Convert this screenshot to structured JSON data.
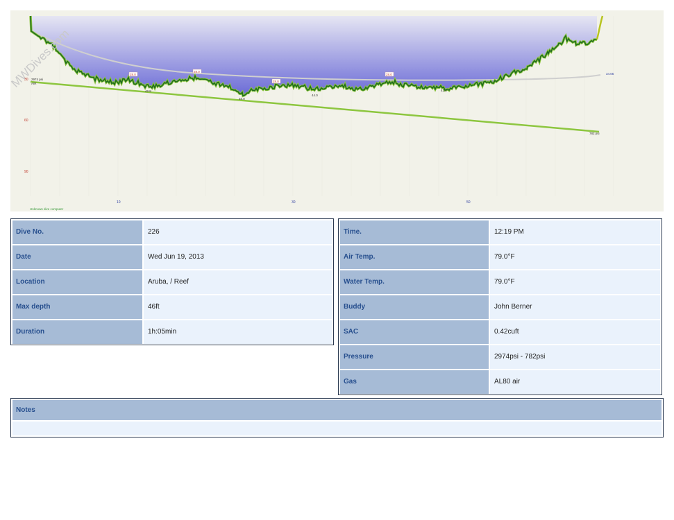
{
  "watermark": "MWDives.com",
  "chart_data": {
    "type": "line",
    "y_ticks": [
      "30",
      "60",
      "90"
    ],
    "x_ticks": [
      "10",
      "30",
      "50"
    ],
    "computer_label": "Unknown dive computer",
    "pressure_start_label": "2974 psi",
    "pressure_start_sub": "AIR",
    "pressure_end_label": "782 psi",
    "temp_end_label": "34.05",
    "depth_labels": [
      "42.8",
      "46.0",
      "44.0",
      "41.0"
    ],
    "temp_labels": [
      "28.0",
      "28.0",
      "28.0",
      "28.0"
    ],
    "xlim": [
      0,
      65
    ],
    "ylim": [
      0,
      100
    ],
    "max_depth": 46,
    "pressure": {
      "start": 2974,
      "end": 782
    }
  },
  "left_table": [
    {
      "label": "Dive No.",
      "value": "226"
    },
    {
      "label": "Date",
      "value": "Wed Jun 19, 2013"
    },
    {
      "label": "Location",
      "value": "Aruba, / Reef"
    },
    {
      "label": "Max depth",
      "value": "46ft"
    },
    {
      "label": "Duration",
      "value": "1h:05min"
    }
  ],
  "right_table": [
    {
      "label": "Time.",
      "value": "12:19 PM"
    },
    {
      "label": "Air Temp.",
      "value": "79.0°F"
    },
    {
      "label": "Water Temp.",
      "value": "79.0°F"
    },
    {
      "label": "Buddy",
      "value": "John Berner"
    },
    {
      "label": "SAC",
      "value": "0.42cuft"
    },
    {
      "label": "Pressure",
      "value": "2974psi - 782psi"
    },
    {
      "label": "Gas",
      "value": "AL80 air"
    }
  ],
  "notes": {
    "label": "Notes",
    "text": ""
  },
  "colors": {
    "header_bg": "#a6bbd6",
    "header_text": "#274f8e",
    "value_bg": "#eaf2fc",
    "depth_line": "#1f6b1f",
    "pressure_line": "#8dc63f"
  }
}
